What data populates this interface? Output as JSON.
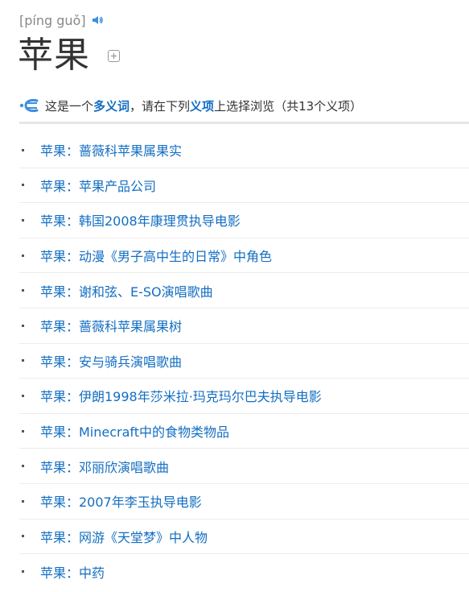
{
  "header": {
    "pinyin": "[píng guǒ]",
    "title": "苹果"
  },
  "notice": {
    "part1": "这是一个",
    "poly_word": "多义词",
    "part2": "，请在下列",
    "sense_word": "义项",
    "part3": "上选择浏览（共13个义项）"
  },
  "colors": {
    "link": "#136ec2",
    "title": "#333333",
    "pinyin": "#888888",
    "icon_blue": "#3d8fe0"
  },
  "icons": {
    "speaker": "speaker-icon",
    "add": "plus-square-icon",
    "polysemy": "polysemy-icon"
  },
  "items": [
    {
      "label": "苹果：蔷薇科苹果属果实"
    },
    {
      "label": "苹果：苹果产品公司"
    },
    {
      "label": "苹果：韩国2008年康理贯执导电影"
    },
    {
      "label": "苹果：动漫《男子高中生的日常》中角色"
    },
    {
      "label": "苹果：谢和弦、E-SO演唱歌曲"
    },
    {
      "label": "苹果：蔷薇科苹果属果树"
    },
    {
      "label": "苹果：安与骑兵演唱歌曲"
    },
    {
      "label": "苹果：伊朗1998年莎米拉·玛克玛尔巴夫执导电影"
    },
    {
      "label": "苹果：Minecraft中的食物类物品"
    },
    {
      "label": "苹果：邓丽欣演唱歌曲"
    },
    {
      "label": "苹果：2007年李玉执导电影"
    },
    {
      "label": "苹果：网游《天堂梦》中人物"
    },
    {
      "label": "苹果：中药"
    }
  ]
}
